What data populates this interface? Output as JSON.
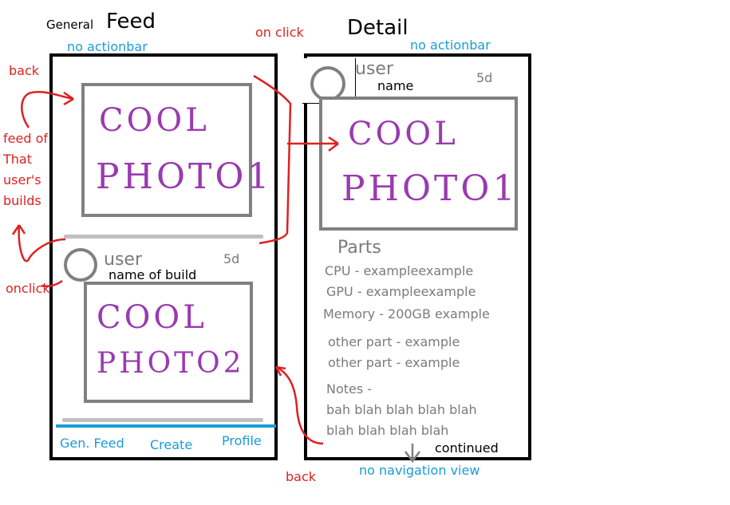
{
  "labels": {
    "general": "General",
    "feed": "Feed",
    "detail": "Detail",
    "no_actionbar_left": "no actionbar",
    "no_actionbar_right": "no actionbar",
    "on_click": "on click",
    "back_top": "back",
    "feed_of_that_users_builds": [
      "feed of",
      "That",
      "user's",
      "builds"
    ],
    "onclick": "onclick",
    "back_bottom": "back",
    "no_navigation_view": "no navigation view",
    "continued": "continued"
  },
  "feed_screen": {
    "post1": {
      "photo_text": [
        "COOL",
        "PHOTO1"
      ]
    },
    "post2": {
      "user": "user",
      "name": "name of build",
      "age": "5d",
      "photo_text": [
        "COOL",
        "PHOTO2"
      ]
    },
    "nav": [
      "Gen. Feed",
      "Create",
      "Profile"
    ]
  },
  "detail_screen": {
    "user": "user",
    "name": "name",
    "age": "5d",
    "photo_text": [
      "COOL",
      "PHOTO1"
    ],
    "parts_heading": "Parts",
    "parts": [
      "CPU - exampleexample",
      "GPU - exampleexample",
      "Memory - 200GB example",
      "other part - example",
      "other part - example"
    ],
    "notes_label": "Notes -",
    "notes": [
      "bah blah blah blah blah",
      "blah blah blah blah"
    ]
  },
  "colors": {
    "annotation_red": "#e02020",
    "annotation_blue": "#1a9bd7",
    "photo_purple": "#9a3ab0",
    "frame_gray": "#808080"
  }
}
